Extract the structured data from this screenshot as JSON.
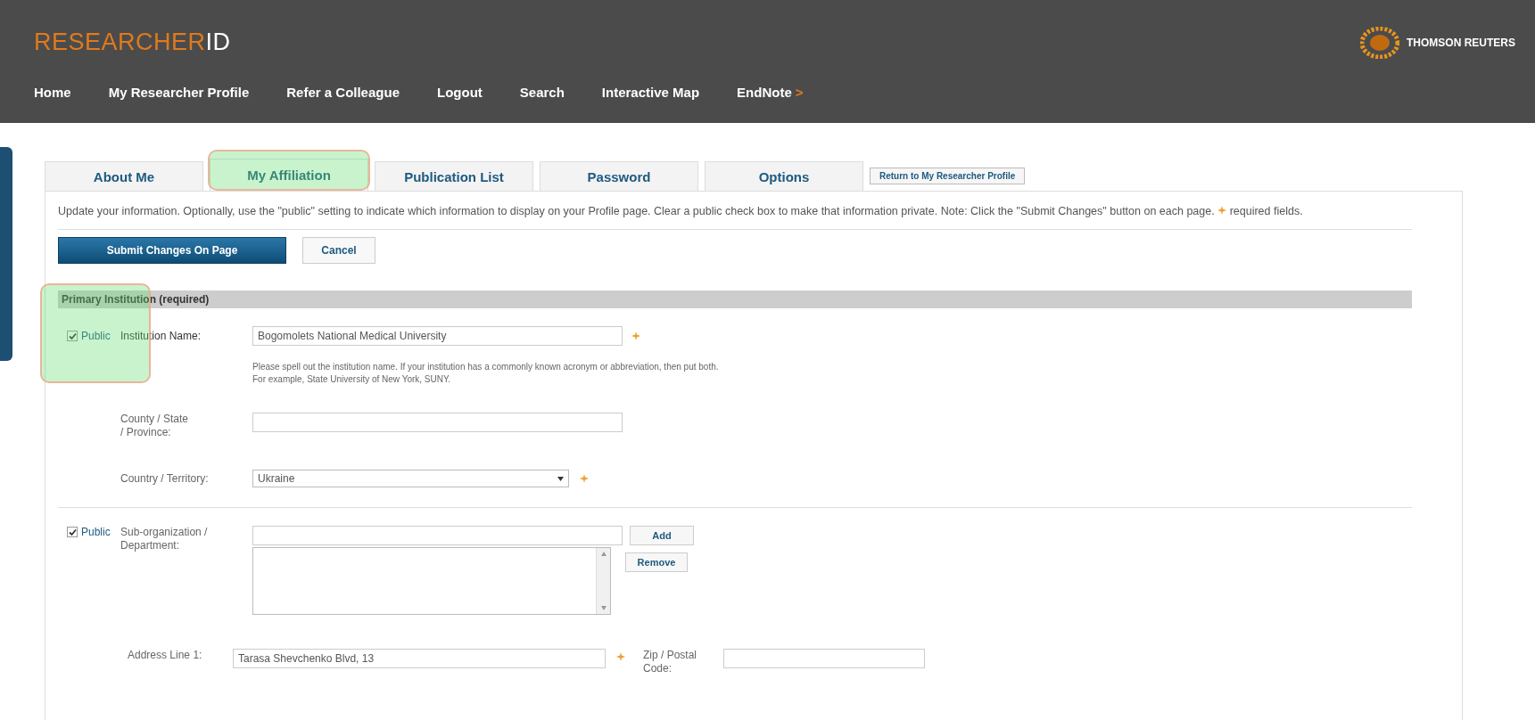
{
  "header": {
    "logo_main": "RESEARCHER",
    "logo_end": "ID",
    "brand": "THOMSON REUTERS",
    "nav": [
      "Home",
      "My Researcher Profile",
      "Refer a Colleague",
      "Logout",
      "Search",
      "Interactive Map",
      "EndNote"
    ],
    "nav_arrow": ">"
  },
  "tabs": [
    {
      "label": "About Me",
      "selected": false,
      "highlighted": false
    },
    {
      "label": "My Affiliation",
      "selected": true,
      "highlighted": true
    },
    {
      "label": "Publication List",
      "selected": false,
      "highlighted": false
    },
    {
      "label": "Password",
      "selected": false,
      "highlighted": false
    },
    {
      "label": "Options",
      "selected": false,
      "highlighted": false
    }
  ],
  "return_link": "Return to My Researcher Profile",
  "intro": "Update your information. Optionally, use the \"public\" setting to indicate which information to display on your Profile page. Clear a public check box to make that information private. Note: Click the \"Submit Changes\" button on each page.",
  "required_note": "required fields.",
  "buttons": {
    "submit": "Submit Changes On Page",
    "cancel": "Cancel"
  },
  "primary": {
    "title": "Primary Institution (required)",
    "public": {
      "label": "Public",
      "checked": true,
      "highlighted": true
    },
    "institution": {
      "label": "Institution Name:",
      "value": "Bogomolets National Medical University",
      "required": true
    },
    "help": "Please spell out the institution name. If your institution has a commonly known acronym or abbreviation, then put both.\nFor example, State University of New York, SUNY.",
    "county": {
      "label": "County / State / Province:"
    },
    "country": {
      "label": "Country / Territory:",
      "value": "Ukraine",
      "required": true
    }
  },
  "sub_org": {
    "public": {
      "label": "Public",
      "checked": true
    },
    "label": "Sub-organization / Department:",
    "add": "Add",
    "remove": "Remove"
  },
  "address": {
    "label": "Address Line 1:",
    "value": "Tarasa Shevchenko Blvd, 13",
    "required": true,
    "zip_label": "Zip / Postal Code:"
  }
}
